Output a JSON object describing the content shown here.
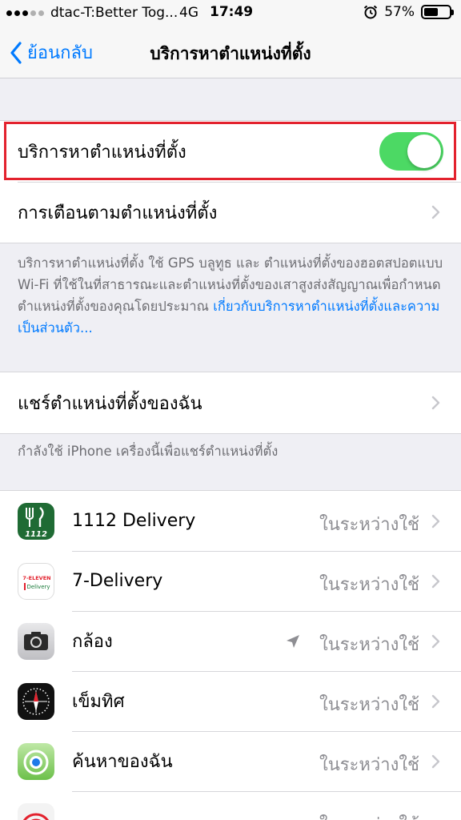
{
  "status_bar": {
    "carrier": "dtac-T:Better Tog...",
    "network": "4G",
    "time": "17:49",
    "battery": "57%",
    "battery_level": 0.57
  },
  "nav": {
    "back_label": "ย้อนกลับ",
    "title": "บริการหาตำแหน่งที่ตั้ง"
  },
  "location_services": {
    "label": "บริการหาตำแหน่งที่ตั้ง",
    "enabled": true
  },
  "location_alerts": {
    "label": "การเตือนตามตำแหน่งที่ตั้ง"
  },
  "footnote": {
    "text": "บริการหาตำแหน่งที่ตั้ง ใช้ GPS บลูทูธ และ ตำแหน่งที่ตั้งของฮอตสปอตแบบ Wi-Fi ที่ใช้ในที่สาธารณะและตำแหน่งที่ตั้งของเสาสูงส่งสัญญาณเพื่อกำหนดตำแหน่งที่ตั้งของคุณโดยประมาณ",
    "link": "เกี่ยวกับบริการหาตำแหน่งที่ตั้งและความเป็นส่วนตัว..."
  },
  "share_location": {
    "label": "แชร์ตำแหน่งที่ตั้งของฉัน",
    "footnote": "กำลังใช้ iPhone เครื่องนี้เพื่อแชร์ตำแหน่งที่ตั้ง"
  },
  "apps": [
    {
      "name": "1112 Delivery",
      "status": "ในระหว่างใช้",
      "icon": "1112-delivery-app-icon",
      "icon_text": "1112"
    },
    {
      "name": "7-Delivery",
      "status": "ในระหว่างใช้",
      "icon": "7-delivery-app-icon",
      "icon_text": "7-ELEVEN",
      "icon_text2": "Delivery"
    },
    {
      "name": "กล้อง",
      "status": "ในระหว่างใช้",
      "icon": "camera-app-icon",
      "recent_use": true
    },
    {
      "name": "เข็มทิศ",
      "status": "ในระหว่างใช้",
      "icon": "compass-app-icon"
    },
    {
      "name": "ค้นหาของฉัน",
      "status": "ในระหว่างใช้",
      "icon": "find-my-app-icon"
    },
    {
      "name": "",
      "status": "ในระหว่างใช้",
      "icon": "partial-app-icon"
    }
  ],
  "colors": {
    "accent": "#007aff",
    "toggle_on": "#4cd964",
    "highlight_border": "#e3222e",
    "background": "#efeff4"
  }
}
